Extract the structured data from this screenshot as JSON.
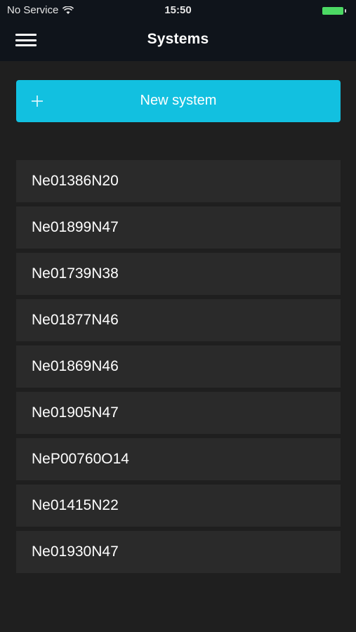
{
  "status_bar": {
    "carrier": "No Service",
    "time": "15:50"
  },
  "header": {
    "title": "Systems",
    "menu_icon": "hamburger-menu-icon"
  },
  "new_system": {
    "label": "New system",
    "icon": "plus-icon"
  },
  "systems": [
    {
      "name": "Ne01386N20"
    },
    {
      "name": "Ne01899N47"
    },
    {
      "name": "Ne01739N38"
    },
    {
      "name": "Ne01877N46"
    },
    {
      "name": "Ne01869N46"
    },
    {
      "name": "Ne01905N47"
    },
    {
      "name": "NeP00760O14"
    },
    {
      "name": "Ne01415N22"
    },
    {
      "name": "Ne01930N47"
    }
  ],
  "colors": {
    "accent": "#12c0e0",
    "header_background": "#0f141b",
    "page_background": "#1f1f1f",
    "list_item_background": "#2a2a2a",
    "battery": "#4cd964"
  }
}
